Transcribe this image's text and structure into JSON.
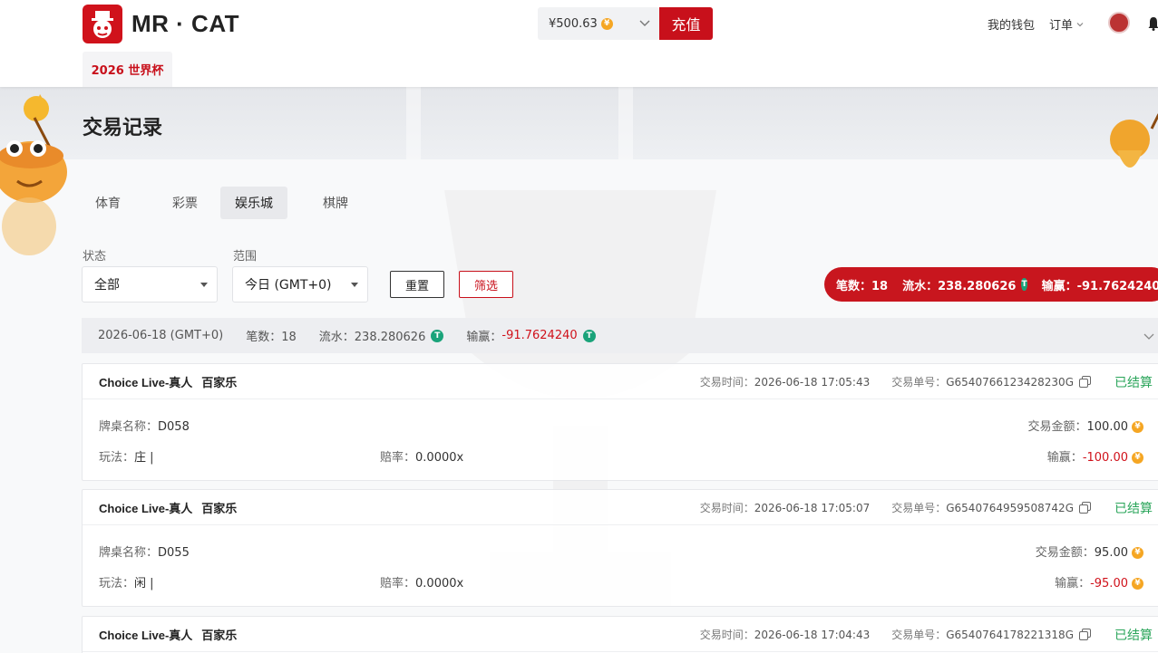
{
  "header": {
    "brand": "MR · CAT",
    "balance": "¥500.63",
    "recharge_label": "充值",
    "wallet_label": "我的钱包",
    "orders_label": "订单",
    "worldcup_tab": "2026 世界杯"
  },
  "page": {
    "title": "交易记录"
  },
  "category_tabs": [
    {
      "label": "体育",
      "active": false
    },
    {
      "label": "彩票",
      "active": false
    },
    {
      "label": "娱乐城",
      "active": true
    },
    {
      "label": "棋牌",
      "active": false
    }
  ],
  "filters": {
    "status_label": "状态",
    "status_value": "全部",
    "range_label": "范围",
    "range_value": "今日 (GMT+0)",
    "reset_label": "重置",
    "filter_label": "筛选"
  },
  "summary": {
    "count": "笔数：18",
    "turnover": "流水：238.280626",
    "winloss": "输赢：-91.7624240"
  },
  "date_group": {
    "date": "2026-06-18 (GMT+0)",
    "count": "笔数：18",
    "turnover": "流水：238.280626",
    "winloss_label": "输赢：",
    "winloss_value": "-91.7624240"
  },
  "labels": {
    "trade_time": "交易时间：",
    "trade_no": "交易单号：",
    "table_name": "牌桌名称：",
    "play": "玩法：",
    "odds": "赔率：",
    "amount": "交易金额：",
    "winloss": "输赢："
  },
  "records": [
    {
      "provider": "Choice Live-真人",
      "game": "百家乐",
      "time": "2026-06-18 17:05:43",
      "order_no": "G6540766123428230G",
      "status": "已结算",
      "table": "D058",
      "play": "庄 |",
      "odds": "0.0000x",
      "amount": "100.00",
      "winloss": "-100.00"
    },
    {
      "provider": "Choice Live-真人",
      "game": "百家乐",
      "time": "2026-06-18 17:05:07",
      "order_no": "G6540764959508742G",
      "status": "已结算",
      "table": "D055",
      "play": "闲 |",
      "odds": "0.0000x",
      "amount": "95.00",
      "winloss": "-95.00"
    },
    {
      "provider": "Choice Live-真人",
      "game": "百家乐",
      "time": "2026-06-18 17:04:43",
      "order_no": "G6540764178221318G",
      "status": "已结算"
    }
  ],
  "colors": {
    "brand_red": "#c8101b",
    "settled_green": "#2aa55a",
    "tether_green": "#1aa37a",
    "coin_gold": "#f5a623"
  },
  "icons": {
    "coin": "gold-coin-icon",
    "tether": "usdt-tether-icon",
    "copy": "copy-icon",
    "chevron": "chevron-down-icon",
    "bell": "bell-icon"
  }
}
